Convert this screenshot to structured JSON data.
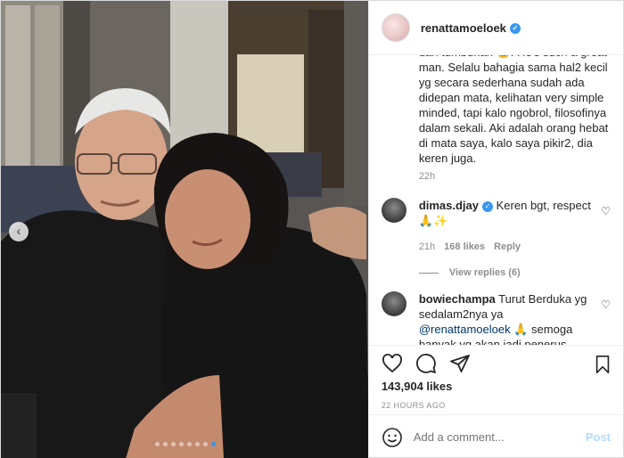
{
  "post": {
    "username": "renattamoeloek",
    "verified": true,
    "caption_text": "dan tumbunan 😅. He's such a great man. Selalu bahagia sama hal2 kecil yg secara sederhana sudah ada didepan mata, kelihatan very simple minded, tapi kalo ngobrol, filosofinya dalam sekali. Aki adalah orang hebat di mata saya, kalo saya pikir2, dia keren juga.",
    "caption_time": "22h",
    "likes": "143,904 likes",
    "posted": "22 HOURS AGO",
    "carousel": {
      "count": 8,
      "active_index": 7
    }
  },
  "comments": [
    {
      "username": "dimas.djay",
      "verified": true,
      "text": "Keren bgt, respect 🙏✨",
      "time": "21h",
      "likes": "168 likes",
      "reply_label": "Reply",
      "view_replies": "View replies (6)"
    },
    {
      "username": "bowiechampa",
      "text": "Turut Berduka yg sedalam2nya ya",
      "mention": "@renattamoeloek",
      "text2": "🙏 semoga banyak yg akan jadi penerus"
    }
  ],
  "add_comment": {
    "placeholder": "Add a comment...",
    "post_label": "Post"
  },
  "icons": {
    "like": "heart-icon",
    "comment": "comment-icon",
    "share": "share-icon",
    "save": "bookmark-icon",
    "emoji": "emoji-icon",
    "prev": "chevron-left-icon"
  },
  "colors": {
    "accent": "#3897f0",
    "muted": "#8e8e8e",
    "text": "#262626",
    "post_disabled": "#b3dbff"
  }
}
